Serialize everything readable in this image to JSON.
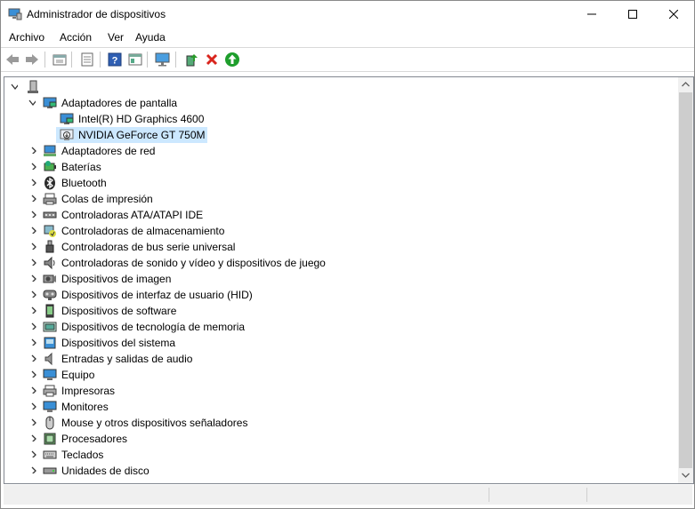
{
  "window": {
    "title": "Administrador de dispositivos"
  },
  "menu": [
    "Archivo",
    "Acción",
    "Ver",
    "Ayuda"
  ],
  "toolbar": {
    "icons": [
      "back-arrow-icon",
      "forward-arrow-icon",
      "properties-icon",
      "driver-list-icon",
      "help-icon",
      "view-icon",
      "monitor-scan-icon",
      "update-driver-icon",
      "uninstall-x-icon",
      "enable-device-icon"
    ],
    "colors": {
      "uninstall": "#d9251d",
      "enable": "#1e9e2c"
    }
  },
  "tree": {
    "root": {
      "label": ""
    },
    "expanded": {
      "label": "Adaptadores de pantalla",
      "children": [
        "Intel(R) HD Graphics 4600",
        "NVIDIA GeForce GT 750M"
      ],
      "selected_child": "NVIDIA GeForce GT 750M"
    },
    "categories": [
      {
        "label": "Adaptadores de red",
        "icon": "network-adapter-icon"
      },
      {
        "label": "Baterías",
        "icon": "battery-icon"
      },
      {
        "label": "Bluetooth",
        "icon": "bluetooth-icon"
      },
      {
        "label": "Colas de impresión",
        "icon": "print-queue-icon"
      },
      {
        "label": "Controladoras ATA/ATAPI IDE",
        "icon": "ide-controller-icon"
      },
      {
        "label": "Controladoras de almacenamiento",
        "icon": "storage-controller-icon"
      },
      {
        "label": "Controladoras de bus serie universal",
        "icon": "usb-icon"
      },
      {
        "label": "Controladoras de sonido y vídeo y dispositivos de juego",
        "icon": "sound-icon"
      },
      {
        "label": "Dispositivos de imagen",
        "icon": "camera-icon"
      },
      {
        "label": "Dispositivos de interfaz de usuario (HID)",
        "icon": "hid-icon"
      },
      {
        "label": "Dispositivos de software",
        "icon": "software-device-icon"
      },
      {
        "label": "Dispositivos de tecnología de memoria",
        "icon": "memory-icon"
      },
      {
        "label": "Dispositivos del sistema",
        "icon": "system-device-icon"
      },
      {
        "label": "Entradas y salidas de audio",
        "icon": "speaker-icon"
      },
      {
        "label": "Equipo",
        "icon": "computer-icon"
      },
      {
        "label": "Impresoras",
        "icon": "printer-icon"
      },
      {
        "label": "Monitores",
        "icon": "monitor-icon"
      },
      {
        "label": "Mouse y otros dispositivos señaladores",
        "icon": "mouse-icon"
      },
      {
        "label": "Procesadores",
        "icon": "processor-icon"
      },
      {
        "label": "Teclados",
        "icon": "keyboard-icon"
      },
      {
        "label": "Unidades de disco",
        "icon": "disk-drive-icon"
      }
    ]
  },
  "colors": {
    "selection": "#cce8ff",
    "accent": "#0078d7"
  }
}
